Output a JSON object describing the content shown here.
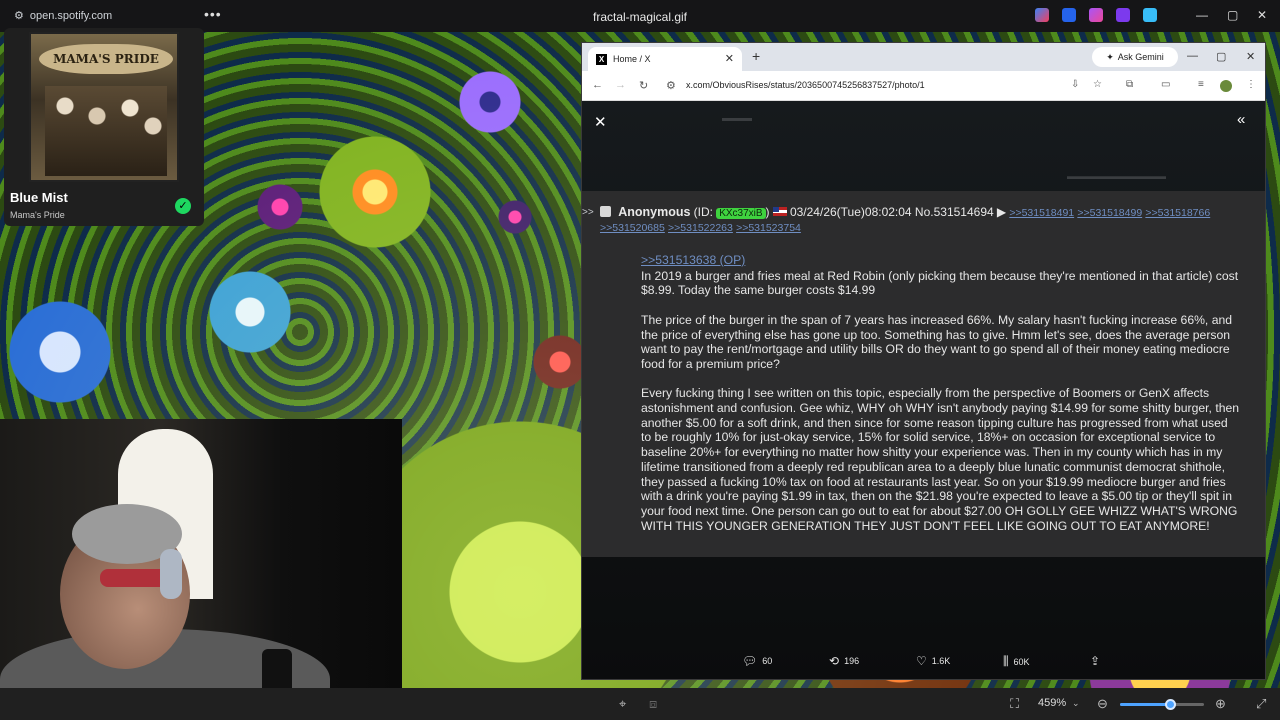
{
  "taskbar": {
    "url_chip": "open.spotify.com",
    "gif_title": "fractal-magical.gif",
    "min": "—",
    "max": "▢",
    "close": "✕"
  },
  "spotify": {
    "album_text": "MAMA'S PRIDE",
    "song": "Blue Mist",
    "artist": "Mama's Pride",
    "check": "✓"
  },
  "browser": {
    "tab_title": "Home / X",
    "new_tab": "+",
    "gemini": "Ask Gemini",
    "url": "x.com/ObviousRises/status/2036500745256837527/photo/1",
    "close_viewer": "✕",
    "collapse": "«"
  },
  "post": {
    "marker": ">>",
    "name": "Anonymous",
    "id_prefix": "(ID:",
    "id_value": "KXc37xiB",
    "id_suffix": ")",
    "datetime": "03/24/26(Tue)08:02:04 No.531514694",
    "replies": [
      ">>531518491",
      ">>531518499",
      ">>531518766",
      ">>531520685",
      ">>531522263",
      ">>531523754"
    ],
    "quote": ">>531513638 (OP)",
    "paragraphs": [
      "In 2019 a burger and fries meal at Red Robin (only picking them because they're mentioned in that article) cost $8.99. Today the same burger costs $14.99",
      "The price of the burger in the span of 7 years has increased 66%. My salary hasn't fucking increase 66%, and the price of everything else has gone up too. Something has to give. Hmm let's see, does the average person want to pay the rent/mortgage and utility bills OR do they want to go spend all of their money eating mediocre food for a premium price?",
      "Every fucking thing I see written on this topic, especially from the perspective of Boomers or GenX affects astonishment and confusion. Gee whiz, WHY oh WHY isn't anybody paying $14.99 for some shitty burger, then another $5.00 for a soft drink, and then since for some reason tipping culture has progressed from what used to be roughly 10% for just-okay service, 15% for solid service, 18%+ on occasion for exceptional service to baseline 20%+ for everything no matter how shitty your experience was. Then in my county which has in my lifetime transitioned from a deeply red republican area to a deeply blue lunatic communist democrat shithole, they passed a fucking 10% tax on food at restaurants last year. So on your $19.99 mediocre burger and fries with a drink you're paying $1.99 in tax, then on the $21.98 you're expected to leave a $5.00 tip or they'll spit in your food next time. One person can go out to eat for about $27.00 OH GOLLY GEE WHIZZ WHAT'S WRONG WITH THIS YOUNGER GENERATION THEY JUST DON'T FEEL LIKE GOING OUT TO EAT ANYMORE!"
    ]
  },
  "action_bar": {
    "comments": "60",
    "reposts": "196",
    "likes": "1.6K",
    "views": "60K"
  },
  "viewer": {
    "zoom": "459%",
    "zoom_fraction": 0.6
  }
}
